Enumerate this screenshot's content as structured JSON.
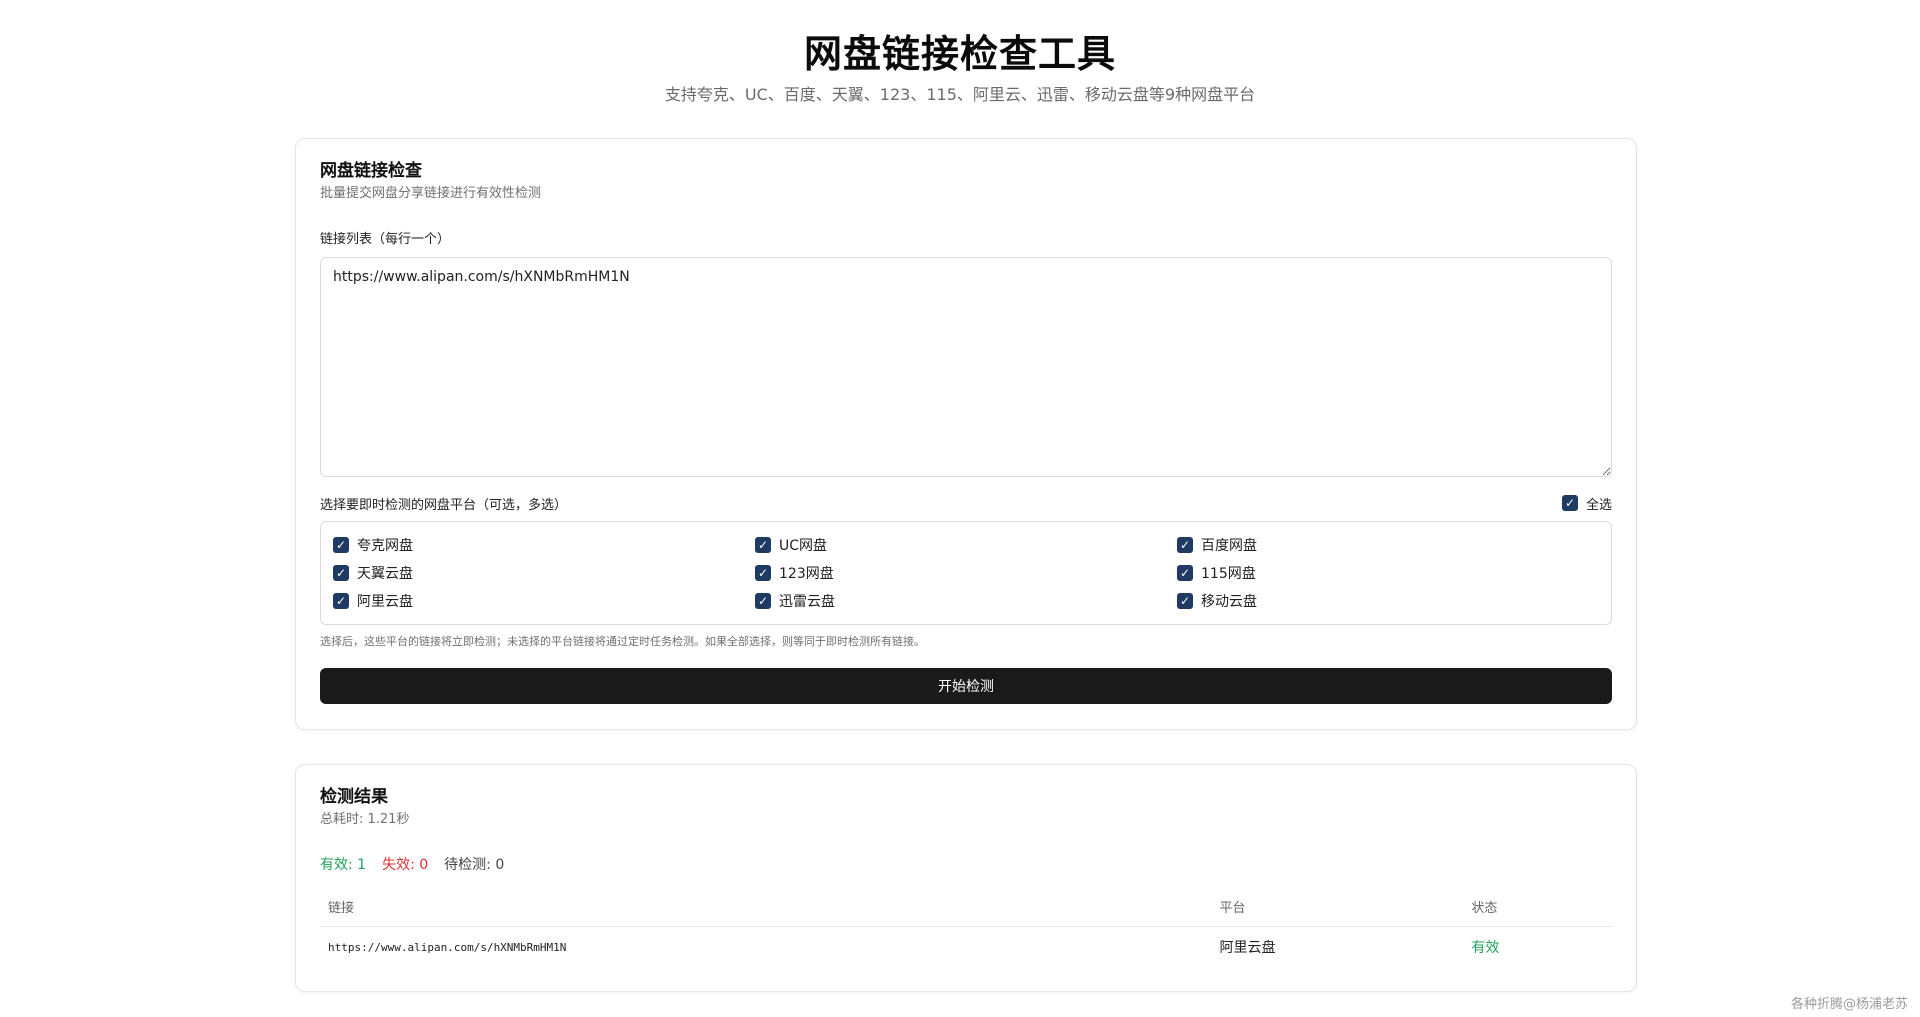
{
  "header": {
    "title": "网盘链接检查工具",
    "subtitle": "支持夸克、UC、百度、天翼、123、115、阿里云、迅雷、移动云盘等9种网盘平台"
  },
  "check": {
    "title": "网盘链接检查",
    "description": "批量提交网盘分享链接进行有效性检测",
    "links_label": "链接列表（每行一个）",
    "links_value": "https://www.alipan.com/s/hXNMbRmHM1N",
    "platform_label": "选择要即时检测的网盘平台（可选，多选）",
    "select_all_label": "全选",
    "platforms": [
      {
        "label": "夸克网盘",
        "checked": true
      },
      {
        "label": "UC网盘",
        "checked": true
      },
      {
        "label": "百度网盘",
        "checked": true
      },
      {
        "label": "天翼云盘",
        "checked": true
      },
      {
        "label": "123网盘",
        "checked": true
      },
      {
        "label": "115网盘",
        "checked": true
      },
      {
        "label": "阿里云盘",
        "checked": true
      },
      {
        "label": "迅雷云盘",
        "checked": true
      },
      {
        "label": "移动云盘",
        "checked": true
      }
    ],
    "note": "选择后，这些平台的链接将立即检测；未选择的平台链接将通过定时任务检测。如果全部选择，则等同于即时检测所有链接。",
    "start_label": "开始检测"
  },
  "results": {
    "title": "检测结果",
    "elapsed": "总耗时: 1.21秒",
    "valid": "有效: 1",
    "invalid": "失效: 0",
    "pending": "待检测: 0",
    "columns": {
      "link": "链接",
      "platform": "平台",
      "status": "状态"
    },
    "rows": [
      {
        "link": "https://www.alipan.com/s/hXNMbRmHM1N",
        "platform": "阿里云盘",
        "status": "有效"
      }
    ]
  },
  "watermark": "各种折腾@杨浦老苏",
  "colors": {
    "accent": "#1f3b63",
    "valid": "#22a35a",
    "invalid": "#e03131",
    "button": "#1a1a1a"
  }
}
